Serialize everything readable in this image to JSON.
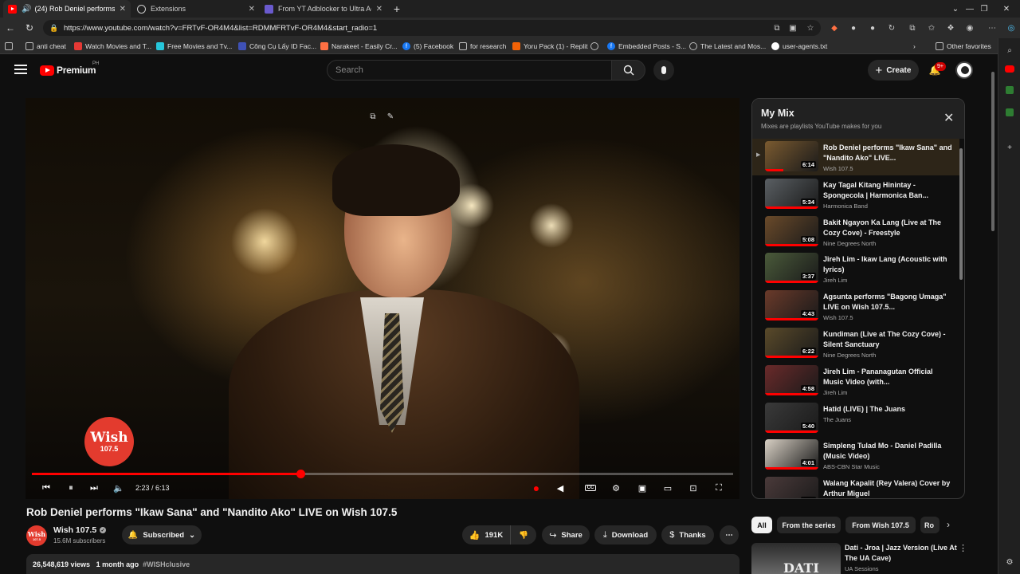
{
  "browser": {
    "tabs": [
      {
        "title": "(24) Rob Deniel performs \"Ik",
        "active": true
      },
      {
        "title": "Extensions",
        "active": false
      },
      {
        "title": "From YT Adblocker to Ultra Adbl",
        "active": false
      }
    ],
    "new_tab": "+",
    "url": "https://www.youtube.com/watch?v=FRTvF-OR4M4&list=RDMMFRTvF-OR4M4&start_radio=1",
    "bookmarks": [
      "anti cheat",
      "Watch Movies and T...",
      "Free Movies and Tv...",
      "Công Cụ Lấy ID Fac...",
      "Narakeet - Easily Cr...",
      "(5) Facebook",
      "for research",
      "Yoru Pack (1) - Replit",
      "Embedded Posts - S...",
      "The Latest and Mos...",
      "user-agents.txt"
    ],
    "other_favorites": "Other favorites"
  },
  "youtube": {
    "logo_text": "Premium",
    "country_code": "PH",
    "search_placeholder": "Search",
    "create_label": "Create",
    "notifications_count": "9+",
    "player": {
      "current_time": "2:23",
      "duration": "6:13",
      "time_display": "2:23 / 6:13",
      "progress": 0.3835,
      "logo_main": "Wish",
      "logo_sub": "107.5"
    },
    "video": {
      "title": "Rob Deniel performs \"Ikaw Sana\" and \"Nandito Ako\" LIVE on Wish 107.5",
      "channel": "Wish 107.5",
      "subscribers": "15.6M subscribers",
      "subscribed_label": "Subscribed",
      "likes": "191K",
      "share_label": "Share",
      "download_label": "Download",
      "thanks_label": "Thanks",
      "views": "26,548,619 views",
      "age": "1 month ago",
      "hashtag": "#WISHclusive"
    },
    "mix": {
      "title": "My Mix",
      "subtitle": "Mixes are playlists YouTube makes for you",
      "items": [
        {
          "title": "Rob Deniel performs \"Ikaw Sana\" and \"Nandito Ako\" LIVE...",
          "channel": "Wish 107.5",
          "duration": "6:14",
          "current": true,
          "thumb_color": "#7a5a30"
        },
        {
          "title": "Kay Tagal Kitang Hinintay - Spongecola | Harmonica Ban...",
          "channel": "Harmonica Band",
          "duration": "5:34",
          "current": false,
          "thumb_color": "#5a5f63"
        },
        {
          "title": "Bakit Ngayon Ka Lang (Live at The Cozy Cove) - Freestyle",
          "channel": "Nine Degrees North",
          "duration": "5:08",
          "current": false,
          "thumb_color": "#6a4a2a"
        },
        {
          "title": "Jireh Lim - Ikaw Lang (Acoustic with lyrics)",
          "channel": "Jireh Lim",
          "duration": "3:37",
          "current": false,
          "thumb_color": "#4a5a3a"
        },
        {
          "title": "Agsunta performs \"Bagong Umaga\" LIVE on Wish 107.5...",
          "channel": "Wish 107.5",
          "duration": "4:43",
          "current": false,
          "thumb_color": "#6a3a2a"
        },
        {
          "title": "Kundiman (Live at The Cozy Cove) - Silent Sanctuary",
          "channel": "Nine Degrees North",
          "duration": "6:22",
          "current": false,
          "thumb_color": "#5a4a2a"
        },
        {
          "title": "Jireh Lim - Pananagutan Official Music Video (with...",
          "channel": "Jireh Lim",
          "duration": "4:58",
          "current": false,
          "thumb_color": "#6a2a2a"
        },
        {
          "title": "Hatid (LIVE) | The Juans",
          "channel": "The Juans",
          "duration": "5:40",
          "current": false,
          "thumb_color": "#3a3a3a"
        },
        {
          "title": "Simpleng Tulad Mo - Daniel Padilla (Music Video)",
          "channel": "ABS-CBN Star Music",
          "duration": "4:01",
          "current": false,
          "thumb_color": "#d8d0c4"
        },
        {
          "title": "Walang Kapalit (Rey Valera) Cover by Arthur Miguel",
          "channel": "",
          "duration": "3:40",
          "current": false,
          "thumb_color": "#4a3a3a"
        }
      ]
    },
    "chips": [
      "All",
      "From the series",
      "From Wish 107.5",
      "Ro"
    ],
    "recommended": {
      "title": "Dati - Jroa | Jazz Version (Live At The UA Cave)",
      "channel": "UA Sessions",
      "thumb_label": "DATI"
    }
  }
}
